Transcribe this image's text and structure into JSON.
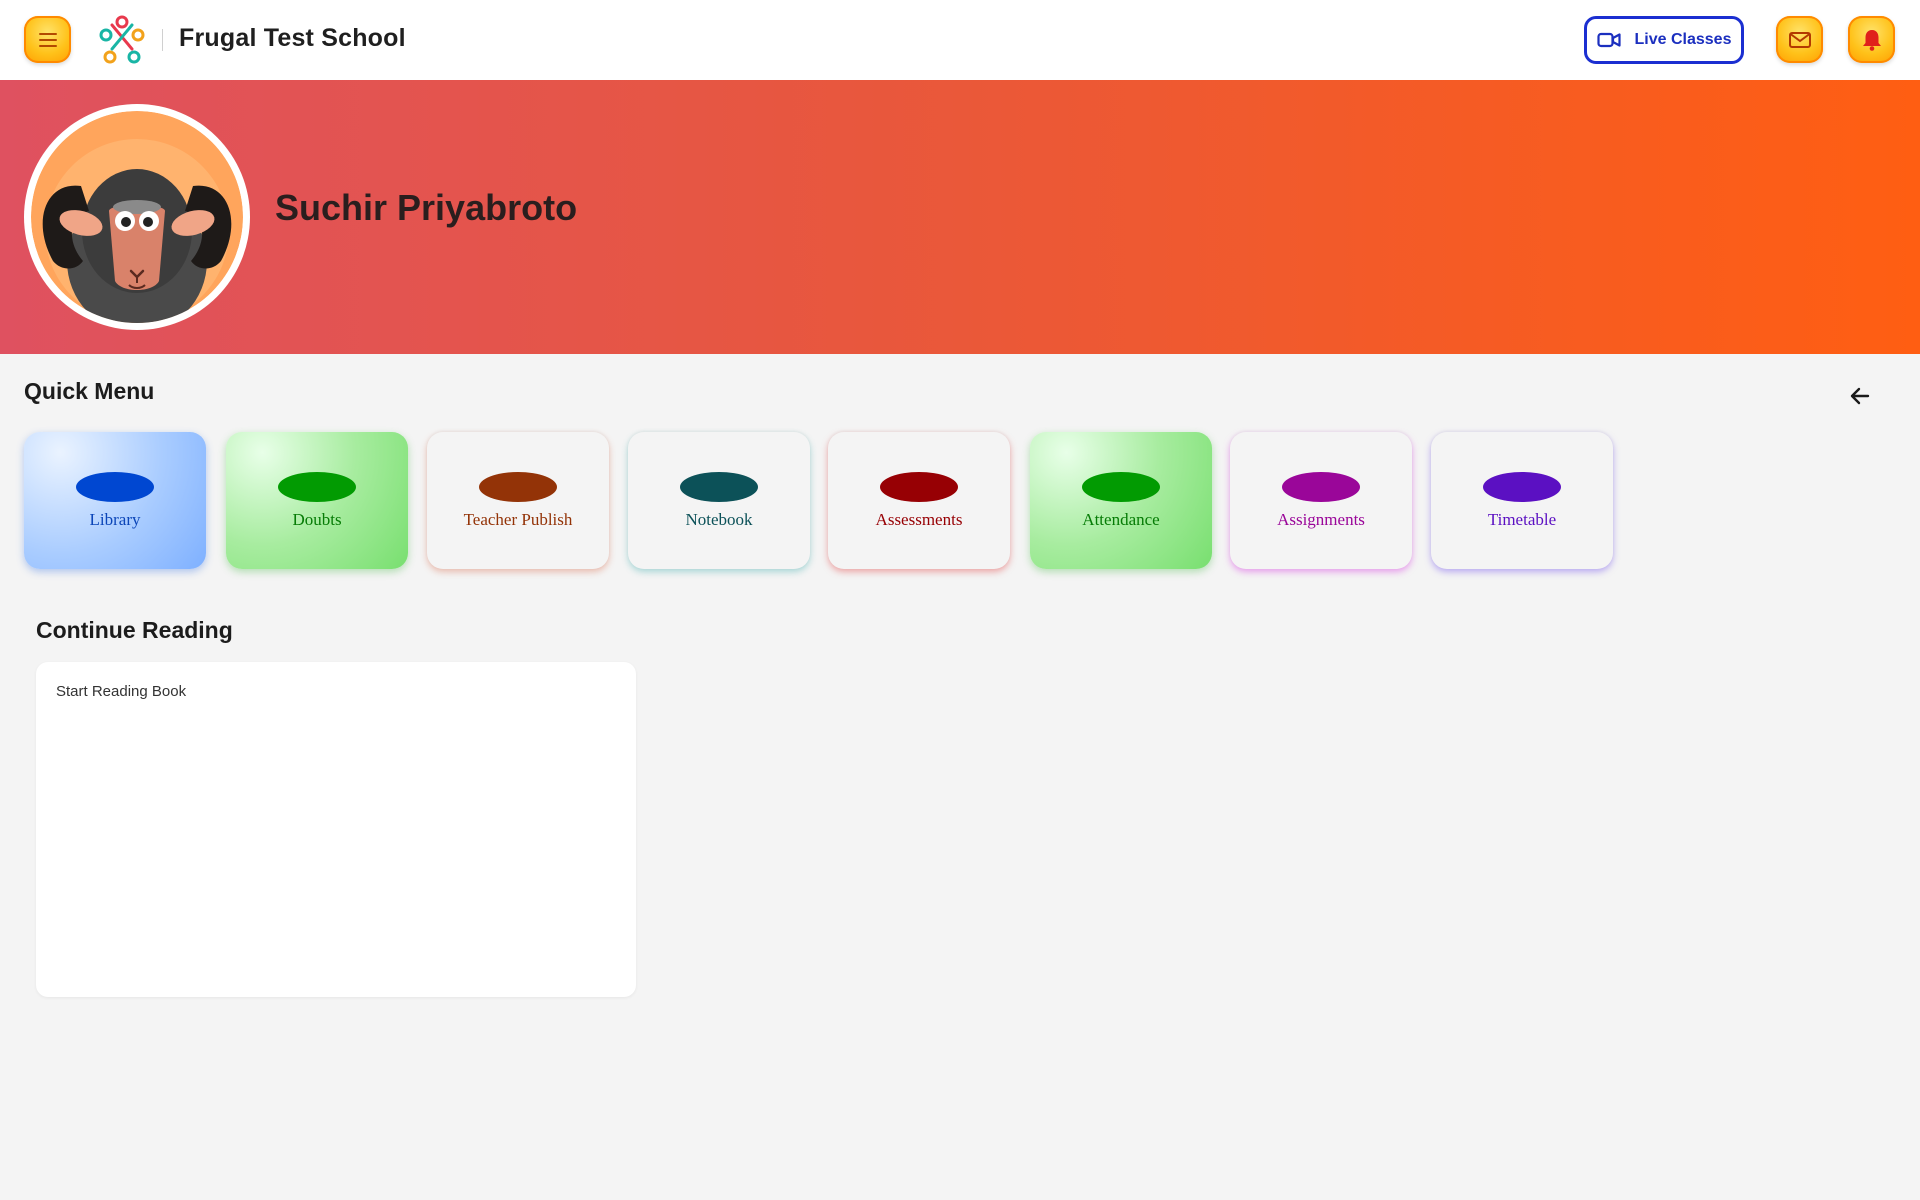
{
  "header": {
    "school_name": "Frugal Test School",
    "menu_icon": "hamburger-menu-icon",
    "logo_icon": "people-circle-logo",
    "live_classes_label": "Live Classes",
    "live_classes_icon": "video-camera-icon",
    "mail_icon": "mail-icon",
    "bell_icon": "bell-icon",
    "accent_color": "#ffc21a"
  },
  "profile": {
    "name": "Suchir Priyabroto",
    "avatar_icon": "ram-avatar"
  },
  "quick_menu": {
    "title": "Quick Menu",
    "back_icon": "arrow-left-icon",
    "items": [
      {
        "label": "Library",
        "color": "#0047d1"
      },
      {
        "label": "Doubts",
        "color": "#029b02"
      },
      {
        "label": "Teacher Publish",
        "color": "#933307"
      },
      {
        "label": "Notebook",
        "color": "#0c5158"
      },
      {
        "label": "Assessments",
        "color": "#970004"
      },
      {
        "label": "Attendance",
        "color": "#029b02"
      },
      {
        "label": "Assignments",
        "color": "#9a0699"
      },
      {
        "label": "Timetable",
        "color": "#5b10c2"
      }
    ]
  },
  "continue_reading": {
    "title": "Continue Reading",
    "card_text": "Start Reading Book"
  }
}
